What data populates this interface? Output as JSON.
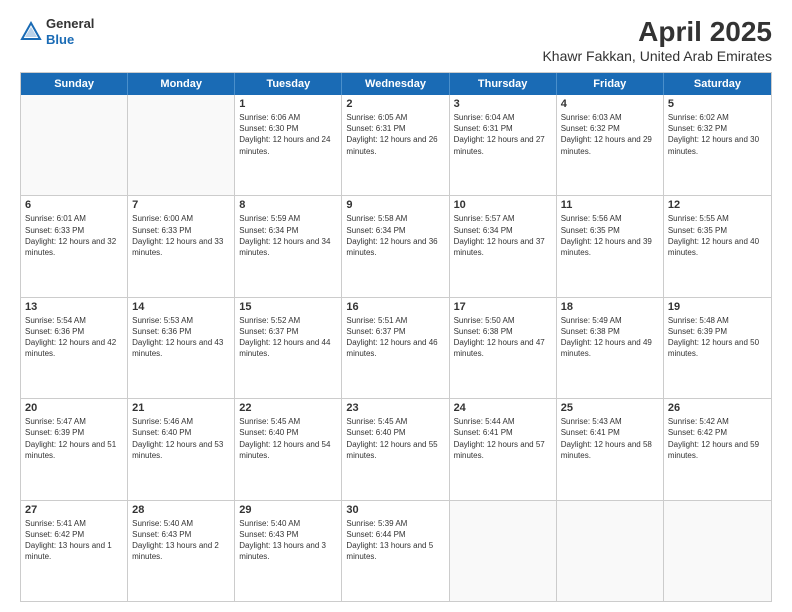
{
  "logo": {
    "general": "General",
    "blue": "Blue"
  },
  "header": {
    "title": "April 2025",
    "subtitle": "Khawr Fakkan, United Arab Emirates"
  },
  "weekdays": [
    "Sunday",
    "Monday",
    "Tuesday",
    "Wednesday",
    "Thursday",
    "Friday",
    "Saturday"
  ],
  "weeks": [
    [
      {
        "day": "",
        "info": ""
      },
      {
        "day": "",
        "info": ""
      },
      {
        "day": "1",
        "info": "Sunrise: 6:06 AM\nSunset: 6:30 PM\nDaylight: 12 hours and 24 minutes."
      },
      {
        "day": "2",
        "info": "Sunrise: 6:05 AM\nSunset: 6:31 PM\nDaylight: 12 hours and 26 minutes."
      },
      {
        "day": "3",
        "info": "Sunrise: 6:04 AM\nSunset: 6:31 PM\nDaylight: 12 hours and 27 minutes."
      },
      {
        "day": "4",
        "info": "Sunrise: 6:03 AM\nSunset: 6:32 PM\nDaylight: 12 hours and 29 minutes."
      },
      {
        "day": "5",
        "info": "Sunrise: 6:02 AM\nSunset: 6:32 PM\nDaylight: 12 hours and 30 minutes."
      }
    ],
    [
      {
        "day": "6",
        "info": "Sunrise: 6:01 AM\nSunset: 6:33 PM\nDaylight: 12 hours and 32 minutes."
      },
      {
        "day": "7",
        "info": "Sunrise: 6:00 AM\nSunset: 6:33 PM\nDaylight: 12 hours and 33 minutes."
      },
      {
        "day": "8",
        "info": "Sunrise: 5:59 AM\nSunset: 6:34 PM\nDaylight: 12 hours and 34 minutes."
      },
      {
        "day": "9",
        "info": "Sunrise: 5:58 AM\nSunset: 6:34 PM\nDaylight: 12 hours and 36 minutes."
      },
      {
        "day": "10",
        "info": "Sunrise: 5:57 AM\nSunset: 6:34 PM\nDaylight: 12 hours and 37 minutes."
      },
      {
        "day": "11",
        "info": "Sunrise: 5:56 AM\nSunset: 6:35 PM\nDaylight: 12 hours and 39 minutes."
      },
      {
        "day": "12",
        "info": "Sunrise: 5:55 AM\nSunset: 6:35 PM\nDaylight: 12 hours and 40 minutes."
      }
    ],
    [
      {
        "day": "13",
        "info": "Sunrise: 5:54 AM\nSunset: 6:36 PM\nDaylight: 12 hours and 42 minutes."
      },
      {
        "day": "14",
        "info": "Sunrise: 5:53 AM\nSunset: 6:36 PM\nDaylight: 12 hours and 43 minutes."
      },
      {
        "day": "15",
        "info": "Sunrise: 5:52 AM\nSunset: 6:37 PM\nDaylight: 12 hours and 44 minutes."
      },
      {
        "day": "16",
        "info": "Sunrise: 5:51 AM\nSunset: 6:37 PM\nDaylight: 12 hours and 46 minutes."
      },
      {
        "day": "17",
        "info": "Sunrise: 5:50 AM\nSunset: 6:38 PM\nDaylight: 12 hours and 47 minutes."
      },
      {
        "day": "18",
        "info": "Sunrise: 5:49 AM\nSunset: 6:38 PM\nDaylight: 12 hours and 49 minutes."
      },
      {
        "day": "19",
        "info": "Sunrise: 5:48 AM\nSunset: 6:39 PM\nDaylight: 12 hours and 50 minutes."
      }
    ],
    [
      {
        "day": "20",
        "info": "Sunrise: 5:47 AM\nSunset: 6:39 PM\nDaylight: 12 hours and 51 minutes."
      },
      {
        "day": "21",
        "info": "Sunrise: 5:46 AM\nSunset: 6:40 PM\nDaylight: 12 hours and 53 minutes."
      },
      {
        "day": "22",
        "info": "Sunrise: 5:45 AM\nSunset: 6:40 PM\nDaylight: 12 hours and 54 minutes."
      },
      {
        "day": "23",
        "info": "Sunrise: 5:45 AM\nSunset: 6:40 PM\nDaylight: 12 hours and 55 minutes."
      },
      {
        "day": "24",
        "info": "Sunrise: 5:44 AM\nSunset: 6:41 PM\nDaylight: 12 hours and 57 minutes."
      },
      {
        "day": "25",
        "info": "Sunrise: 5:43 AM\nSunset: 6:41 PM\nDaylight: 12 hours and 58 minutes."
      },
      {
        "day": "26",
        "info": "Sunrise: 5:42 AM\nSunset: 6:42 PM\nDaylight: 12 hours and 59 minutes."
      }
    ],
    [
      {
        "day": "27",
        "info": "Sunrise: 5:41 AM\nSunset: 6:42 PM\nDaylight: 13 hours and 1 minute."
      },
      {
        "day": "28",
        "info": "Sunrise: 5:40 AM\nSunset: 6:43 PM\nDaylight: 13 hours and 2 minutes."
      },
      {
        "day": "29",
        "info": "Sunrise: 5:40 AM\nSunset: 6:43 PM\nDaylight: 13 hours and 3 minutes."
      },
      {
        "day": "30",
        "info": "Sunrise: 5:39 AM\nSunset: 6:44 PM\nDaylight: 13 hours and 5 minutes."
      },
      {
        "day": "",
        "info": ""
      },
      {
        "day": "",
        "info": ""
      },
      {
        "day": "",
        "info": ""
      }
    ]
  ]
}
